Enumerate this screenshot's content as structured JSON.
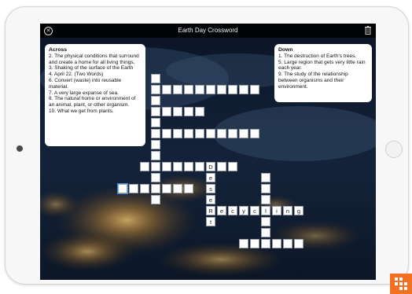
{
  "app": {
    "title": "Earth Day Crossword",
    "close_icon": "close-icon",
    "trash_icon": "trash-icon"
  },
  "across": {
    "heading": "Across",
    "clues": [
      "2. The physical conditions that surround and create a home for all living things.",
      "3. Shaking of the surface of the Earth",
      "4. April 22. (Two Words)",
      "6. Convert (waste) into reusable material.",
      "7. A very large expanse of sea.",
      "8. The natural home or environment of an animal, plant, or other organism.",
      "10. What we get from plants."
    ]
  },
  "down": {
    "heading": "Down",
    "clues": [
      "1. The destruction of Earth's trees.",
      "5. Large region that gets very little rain each year.",
      "9. The study of the relationship between organisms and their environment."
    ]
  },
  "answers": {
    "desert": [
      "D",
      "e",
      "s",
      "e",
      "R",
      "t"
    ],
    "recycling": [
      "e",
      "c",
      "y",
      "c",
      "l",
      "i",
      "n",
      "g"
    ]
  },
  "colors": {
    "accent": "#f36f21",
    "cell_border": "#9aa0aa",
    "selection": "#3b8be8"
  }
}
